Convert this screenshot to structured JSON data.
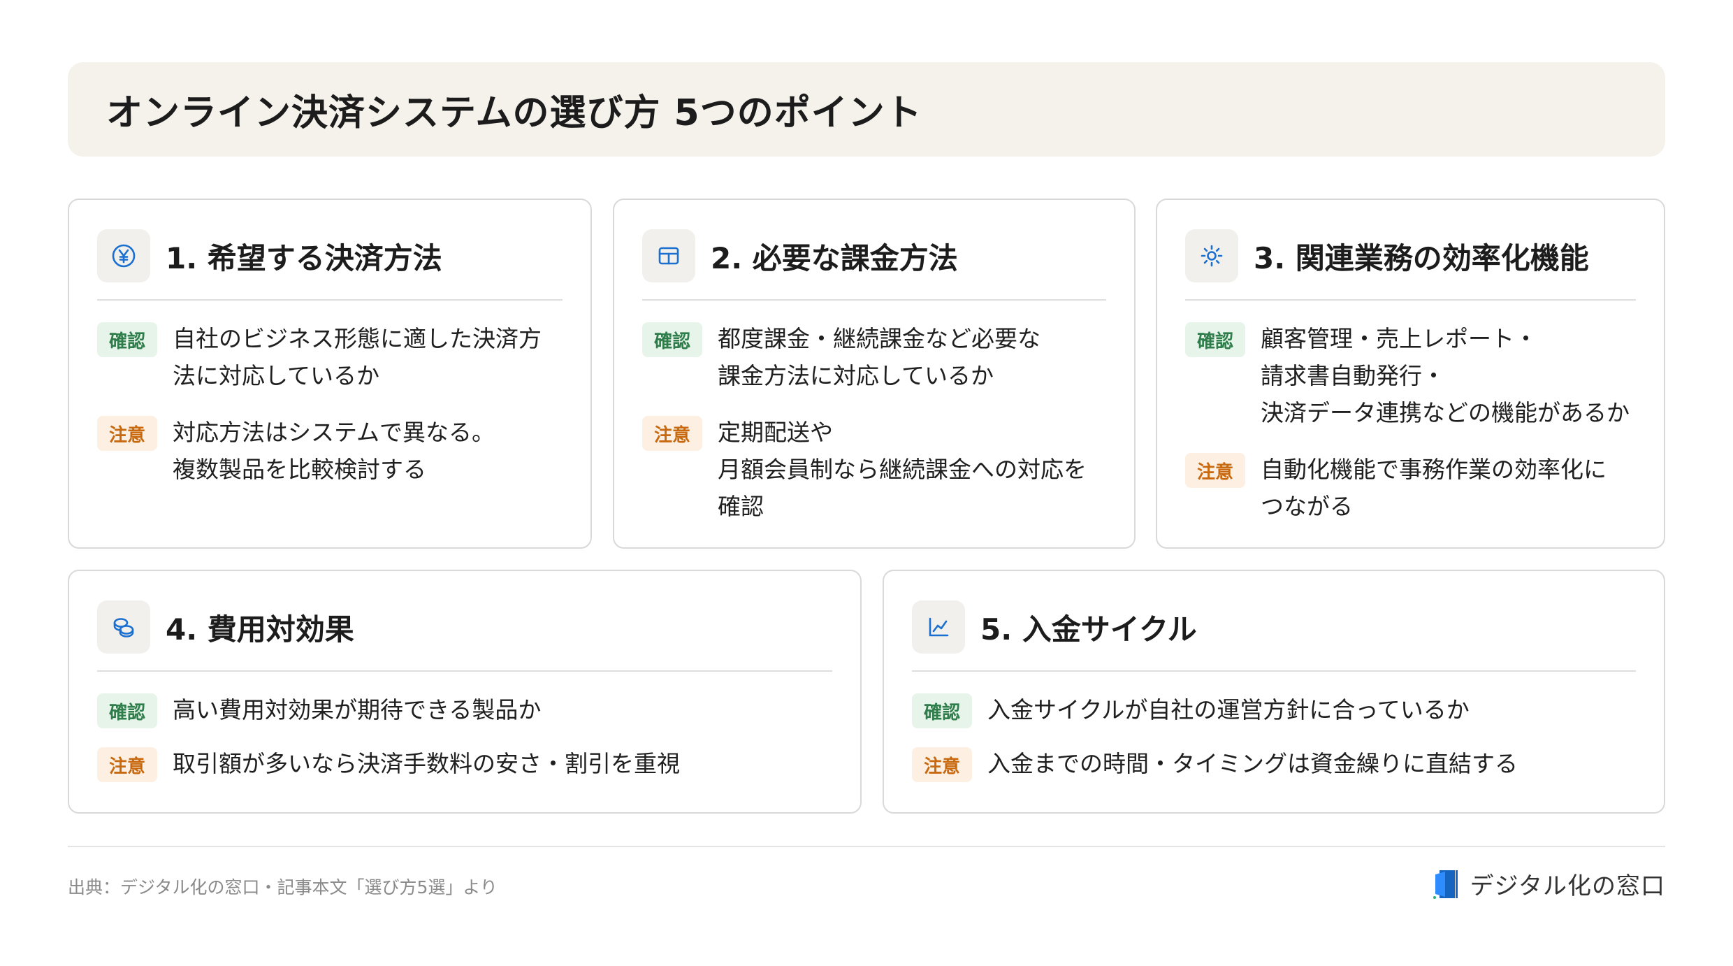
{
  "title": "オンライン決済システムの選び方 5つのポイント",
  "labels": {
    "confirm": "確認",
    "caution": "注意"
  },
  "colors": {
    "accent_icon": "#1a6fd1",
    "confirm_bg": "#e6f4ea",
    "confirm_text": "#2e7d4a",
    "caution_bg": "#fdf0e2",
    "caution_text": "#c8690f",
    "title_bg": "#f5f2ec"
  },
  "cards": [
    {
      "icon": "yen-circle-icon",
      "title": "1. 希望する決済方法",
      "confirm": "自社のビジネス形態に適した決済方\n法に対応しているか",
      "caution": "対応方法はシステムで異なる。\n複数製品を比較検討する"
    },
    {
      "icon": "table-icon",
      "title": "2. 必要な課金方法",
      "confirm": "都度課金・継続課金など必要な\n課金方法に対応しているか",
      "caution": "定期配送や\n月額会員制なら継続課金への対応を\n確認"
    },
    {
      "icon": "sun-gear-icon",
      "title": "3. 関連業務の効率化機能",
      "confirm": "顧客管理・売上レポート・\n請求書自動発行・\n決済データ連携などの機能があるか",
      "caution": "自動化機能で事務作業の効率化に\nつながる"
    },
    {
      "icon": "coins-icon",
      "title": "4. 費用対効果",
      "confirm": "高い費用対効果が期待できる製品か",
      "caution": "取引額が多いなら決済手数料の安さ・割引を重視"
    },
    {
      "icon": "line-chart-icon",
      "title": "5. 入金サイクル",
      "confirm": "入金サイクルが自社の運営方針に合っているか",
      "caution": "入金までの時間・タイミングは資金繰りに直結する"
    }
  ],
  "footer": {
    "source": "出典：デジタル化の窓口・記事本文「選び方5選」より",
    "logo_text": "デジタル化の窓口"
  }
}
